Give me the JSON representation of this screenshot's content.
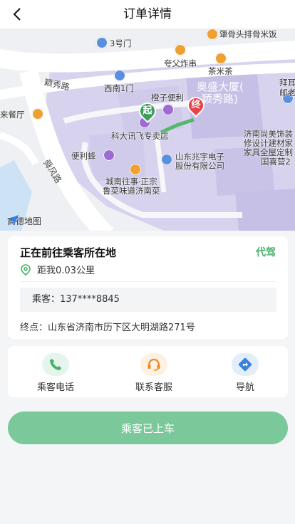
{
  "header": {
    "title": "订单详情"
  },
  "map": {
    "labels": {
      "lbl_3hao": "3号门",
      "lbl_qigu": "犟骨头排骨米饭",
      "lbl_kuafu": "夸父炸串",
      "lbl_chami": "茶米茶",
      "lbl_yingxiu": "颖秀路",
      "lbl_xinan": "西南1门",
      "lbl_aosheng": "奥盛大厦(",
      "lbl_aosheng2": "颖秀路)",
      "lbl_baite": "拜耳",
      "lbl_laolao": "邮老",
      "lbl_chengzi": "橙子便利",
      "lbl_laicanting": "来餐厅",
      "lbl_kedaxunfei": "科大讯飞专卖店",
      "lbl_jinan_shangmei": "济南尚美饰装",
      "lbl_xiushe": "修设计建材家",
      "lbl_jiaju": "家具全屋定制",
      "lbl_guoxin": "国喜营2",
      "lbl_bianlifeng": "便利蜂",
      "lbl_zhaoyu": "山东兆宇电子",
      "lbl_zhaoyu2": "股份有限公司",
      "lbl_shunfeng": "舜风路",
      "lbl_chengnan": "城南往事·正宗",
      "lbl_chengnan2": "鲁菜味道济南菜",
      "lbl_amap": "高德地图"
    },
    "pins": {
      "start": "起",
      "end": "终"
    }
  },
  "order": {
    "status": "正在前往乘客所在地",
    "service_type": "代驾",
    "distance": "距我0.03公里",
    "passenger": "乘客：137****8845",
    "destination": "终点：山东省济南市历下区大明湖路271号"
  },
  "actions": [
    {
      "label": "乘客电话",
      "icon": "phone-icon"
    },
    {
      "label": "联系客服",
      "icon": "headset-icon"
    },
    {
      "label": "导航",
      "icon": "navigation-icon"
    }
  ],
  "primary_button": {
    "label": "乘客已上车"
  },
  "colors": {
    "accent_green": "#45b26b",
    "button_green": "#7bc89a",
    "map_building": "#c9c4e6",
    "end_pin_red": "#e8434a",
    "start_pin_green": "#3d9d5a"
  }
}
